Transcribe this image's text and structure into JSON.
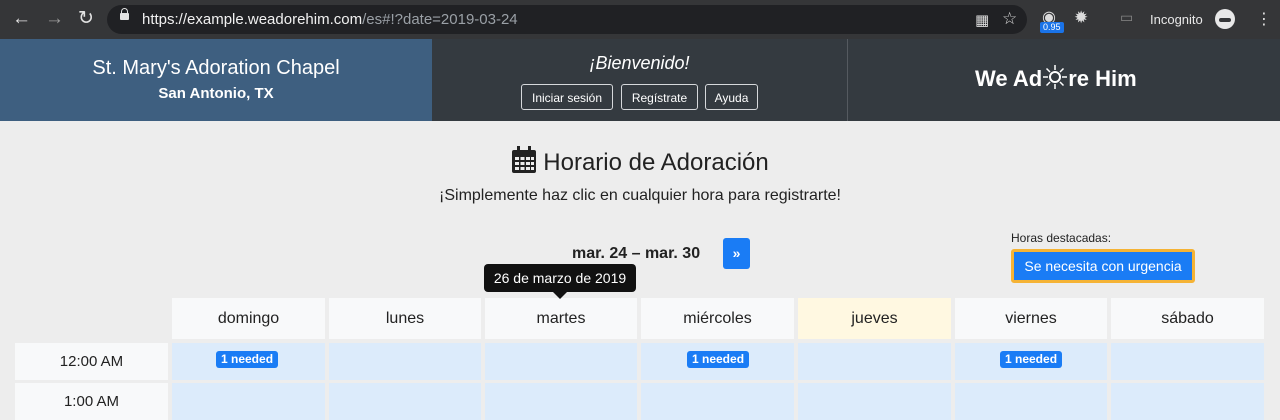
{
  "browser": {
    "url_host": "https://example.weadorehim.com",
    "url_path": "/es#!?date=2019-03-24",
    "ext_badge": "0.95",
    "incognito_label": "Incognito"
  },
  "header": {
    "chapel_name": "St. Mary's Adoration Chapel",
    "city": "San Antonio, TX",
    "welcome": "¡Bienvenido!",
    "login_label": "Iniciar sesión",
    "register_label": "Regístrate",
    "help_label": "Ayuda",
    "logo_prefix": "We Ad",
    "logo_suffix": "re Him"
  },
  "schedule": {
    "title": "Horario de Adoración",
    "subtitle": "¡Simplemente haz clic en cualquier hora para registrarte!",
    "week_range": "mar. 24 – mar. 30",
    "next_label": "»",
    "highlight_label": "Horas destacadas:",
    "urgent_label": "Se necesita con urgencia",
    "tooltip": "26 de marzo de 2019",
    "days": [
      "domingo",
      "lunes",
      "martes",
      "miércoles",
      "jueves",
      "viernes",
      "sábado"
    ],
    "rows": [
      {
        "time": "12:00 AM",
        "needed": [
          "1 needed",
          "",
          "",
          "1 needed",
          "",
          "1 needed",
          ""
        ]
      },
      {
        "time": "1:00 AM",
        "needed": [
          "",
          "",
          "",
          "",
          "",
          "",
          ""
        ]
      }
    ]
  },
  "colors": {
    "accent": "#1a7cf5",
    "header_blue": "#3e5f80",
    "header_dark": "#343a40",
    "slot_blue": "#dcebfb",
    "today_bg": "#fff8e1",
    "urgent_border": "#f5b335"
  }
}
